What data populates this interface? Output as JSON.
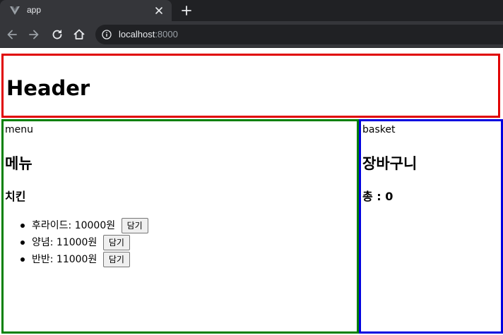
{
  "browser": {
    "tab_title": "app",
    "url_host": "localhost",
    "url_port": ":8000"
  },
  "page": {
    "header": {
      "title": "Header"
    },
    "menu": {
      "label": "menu",
      "title": "메뉴",
      "category": "치킨",
      "items": [
        {
          "name": "후라이드",
          "price": " : 10000원",
          "add_label": "담기"
        },
        {
          "name": "양념",
          "price": " : 11000원",
          "add_label": "담기"
        },
        {
          "name": "반반",
          "price": " : 11000원",
          "add_label": "담기"
        }
      ]
    },
    "basket": {
      "label": "basket",
      "title": "장바구니",
      "total": "총 : 0"
    }
  },
  "colors": {
    "header_border": "#e00000",
    "menu_border": "#008000",
    "basket_border": "#0000e0"
  }
}
